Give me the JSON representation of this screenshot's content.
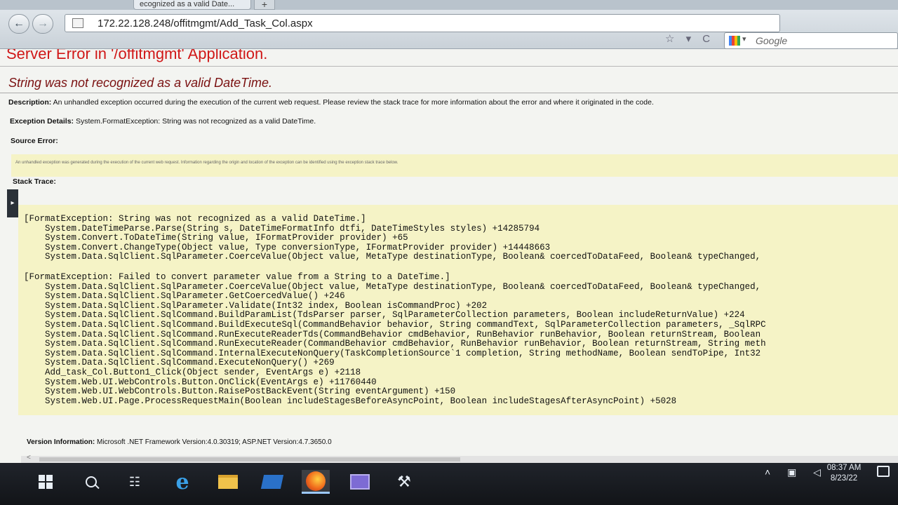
{
  "browser": {
    "tab_title": "ecognized as a valid Date...",
    "new_tab_label": "+",
    "back_glyph": "←",
    "forward_glyph": "→",
    "url": "172.22.128.248/offitmgmt/Add_Task_Col.aspx",
    "url_action_glyphs": "☆ ▾ C",
    "search_placeholder": "Google",
    "search_engine_icon": "google-icon"
  },
  "page": {
    "error_title": "Server Error in '/offitmgmt' Application.",
    "error_message": "String was not recognized as a valid DateTime.",
    "description_label": "Description:",
    "description_text": "An unhandled exception occurred during the execution of the current web request. Please review the stack trace for more information about the error and where it originated in the code.",
    "exception_label": "Exception Details:",
    "exception_text": "System.FormatException: String was not recognized as a valid DateTime.",
    "source_error_label": "Source Error:",
    "source_error_text": "An unhandled exception was generated during the execution of the current web request. Information regarding the origin and location of the exception can be identified using the exception stack trace below.",
    "stack_trace_label": "Stack Trace:",
    "stack_block1": [
      "[FormatException: String was not recognized as a valid DateTime.]",
      "System.DateTimeParse.Parse(String s, DateTimeFormatInfo dtfi, DateTimeStyles styles) +14285794",
      "System.Convert.ToDateTime(String value, IFormatProvider provider) +65",
      "System.Convert.ChangeType(Object value, Type conversionType, IFormatProvider provider) +14448663",
      "System.Data.SqlClient.SqlParameter.CoerceValue(Object value, MetaType destinationType, Boolean& coercedToDataFeed, Boolean& typeChanged,"
    ],
    "stack_block2": [
      "[FormatException: Failed to convert parameter value from a String to a DateTime.]",
      "System.Data.SqlClient.SqlParameter.CoerceValue(Object value, MetaType destinationType, Boolean& coercedToDataFeed, Boolean& typeChanged,",
      "System.Data.SqlClient.SqlParameter.GetCoercedValue() +246",
      "System.Data.SqlClient.SqlParameter.Validate(Int32 index, Boolean isCommandProc) +202",
      "System.Data.SqlClient.SqlCommand.BuildParamList(TdsParser parser, SqlParameterCollection parameters, Boolean includeReturnValue) +224",
      "System.Data.SqlClient.SqlCommand.BuildExecuteSql(CommandBehavior behavior, String commandText, SqlParameterCollection parameters, _SqlRPC",
      "System.Data.SqlClient.SqlCommand.RunExecuteReaderTds(CommandBehavior cmdBehavior, RunBehavior runBehavior, Boolean returnStream, Boolean",
      "System.Data.SqlClient.SqlCommand.RunExecuteReader(CommandBehavior cmdBehavior, RunBehavior runBehavior, Boolean returnStream, String meth",
      "System.Data.SqlClient.SqlCommand.InternalExecuteNonQuery(TaskCompletionSource`1 completion, String methodName, Boolean sendToPipe, Int32",
      "System.Data.SqlClient.SqlCommand.ExecuteNonQuery() +269",
      "Add_task_Col.Button1_Click(Object sender, EventArgs e) +2118",
      "System.Web.UI.WebControls.Button.OnClick(EventArgs e) +11760440",
      "System.Web.UI.WebControls.Button.RaisePostBackEvent(String eventArgument) +150",
      "System.Web.UI.Page.ProcessRequestMain(Boolean includeStagesBeforeAsyncPoint, Boolean includeStagesAfterAsyncPoint) +5028"
    ],
    "version_label": "Version Information:",
    "version_text": "Microsoft .NET Framework Version:4.0.30319; ASP.NET Version:4.7.3650.0",
    "side_handle_glyph": "▸",
    "scroll_left_glyph": "<"
  },
  "taskbar": {
    "items": [
      "windows-start-icon",
      "search-icon",
      "task-view-icon",
      "internet-explorer-icon",
      "file-explorer-icon",
      "powershell-icon",
      "firefox-icon",
      "visual-studio-icon",
      "server-manager-icon"
    ],
    "taskview_glyph": "☷",
    "ie_glyph": "e",
    "tools_glyph": "⚒",
    "tray_glyphs": "˄ ▣ ◁",
    "time": "08:37 AM",
    "date": "8/23/22"
  }
}
